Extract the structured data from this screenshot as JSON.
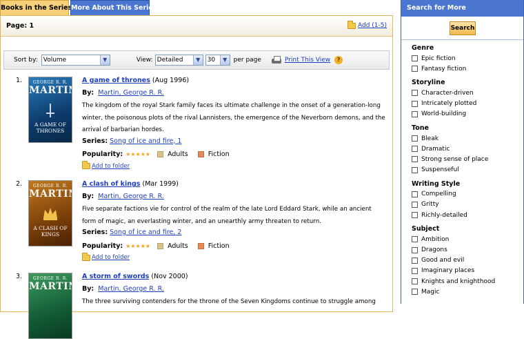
{
  "tabs": [
    {
      "label": "Books in the Series",
      "active": true
    },
    {
      "label": "More About This Series",
      "active": false
    }
  ],
  "pagebar": {
    "page_label": "Page: 1",
    "add_label": "Add (1-5)"
  },
  "sortbar": {
    "sort_label": "Sort by:",
    "sort_value": "Volume",
    "view_label": "View:",
    "view_value": "Detailed",
    "per_page_value": "30",
    "per_page_label": "per page",
    "print_label": "Print This View"
  },
  "books": [
    {
      "num": "1.",
      "cover_author_small": "GEORGE R. R.",
      "cover_author_big": "MARTIN",
      "cover_title": "A GAME OF THRONES",
      "title": "A game of thrones",
      "date": "(Aug 1996)",
      "by_label": "By:",
      "author": "Martin, George R. R.",
      "description": "The kingdom of the royal Stark family faces its ultimate challenge in the onset of a generation-long winter, the poisonous plots of the rival Lannisters, the emergence of the Neverborn demons, and the arrival of barbarian hordes.",
      "series_label": "Series:",
      "series": "Song of ice and fire, 1",
      "popularity_label": "Popularity:",
      "stars": "★★★★★",
      "audience": "Adults",
      "genre": "Fiction",
      "add_folder": "Add to folder"
    },
    {
      "num": "2.",
      "cover_author_small": "GEORGE R. R.",
      "cover_author_big": "MARTIN",
      "cover_title": "A CLASH OF KINGS",
      "title": "A clash of kings",
      "date": "(Mar 1999)",
      "by_label": "By:",
      "author": "Martin, George R. R.",
      "description": "Five separate factions vie for control of the realm of the late Lord Eddard Stark, while an ancient form of magic, an everlasting winter, and an unearthly army threaten to return.",
      "series_label": "Series:",
      "series": "Song of ice and fire, 2",
      "popularity_label": "Popularity:",
      "stars": "★★★★★",
      "audience": "Adults",
      "genre": "Fiction",
      "add_folder": "Add to folder"
    },
    {
      "num": "3.",
      "cover_author_small": "GEORGE R. R.",
      "cover_author_big": "MARTIN",
      "title": "A storm of swords",
      "date": "(Nov 2000)",
      "by_label": "By:",
      "author": "Martin, George R. R.",
      "description": "The three surviving contenders for the throne of the Seven Kingdoms continue to struggle among"
    }
  ],
  "right": {
    "header": "Search for More",
    "search_button": "Search",
    "facets": [
      {
        "head": "Genre",
        "items": [
          "Epic fiction",
          "Fantasy fiction"
        ]
      },
      {
        "head": "Storyline",
        "items": [
          "Character-driven",
          "Intricately plotted",
          "World-building"
        ]
      },
      {
        "head": "Tone",
        "items": [
          "Bleak",
          "Dramatic",
          "Strong sense of place",
          "Suspenseful"
        ]
      },
      {
        "head": "Writing Style",
        "items": [
          "Compelling",
          "Gritty",
          "Richly-detailed"
        ]
      },
      {
        "head": "Subject",
        "items": [
          "Ambition",
          "Dragons",
          "Good and evil",
          "Imaginary places",
          "Knights and knighthood",
          "Magic"
        ]
      }
    ]
  },
  "colors": {
    "tab_active": "#f6d07a",
    "tab_inactive": "#4a76cf",
    "link": "#1f3fbf",
    "stars": "#f1a21b"
  }
}
